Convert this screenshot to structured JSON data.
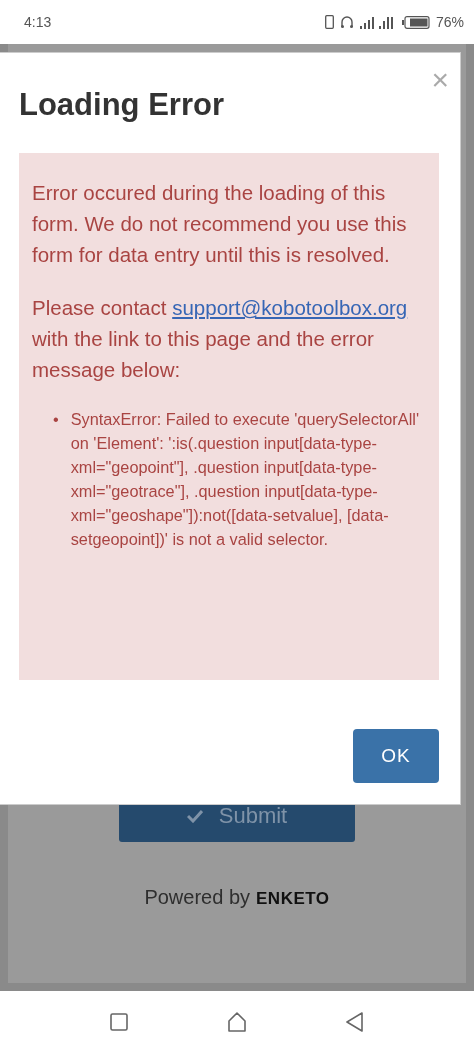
{
  "status_bar": {
    "time": "4:13",
    "battery": "76%"
  },
  "form": {
    "submit_button": "Submit",
    "powered_by": "Powered by",
    "brand": "ENKETO"
  },
  "dialog": {
    "title": "Loading Error",
    "close": "×",
    "message": [
      "Error occured during the loading of this form. We do not recommend you use this form for data entry until this is resolved."
    ],
    "contact": {
      "before": "Please contact",
      "link": "support@kobotoolbox.org",
      "after": "with the link to this page and the error message below:"
    },
    "bullet": "•",
    "errors": [
      "SyntaxError: Failed to execute 'querySelectorAll' on 'Element': ':is(.question input[data-type-xml=\"geopoint\"], .question input[data-type-xml=\"geotrace\"], .question input[data-type-xml=\"geoshape\"]):not([data-setvalue], [data-setgeopoint])' is not a valid selector."
    ],
    "ok_button": "OK"
  }
}
